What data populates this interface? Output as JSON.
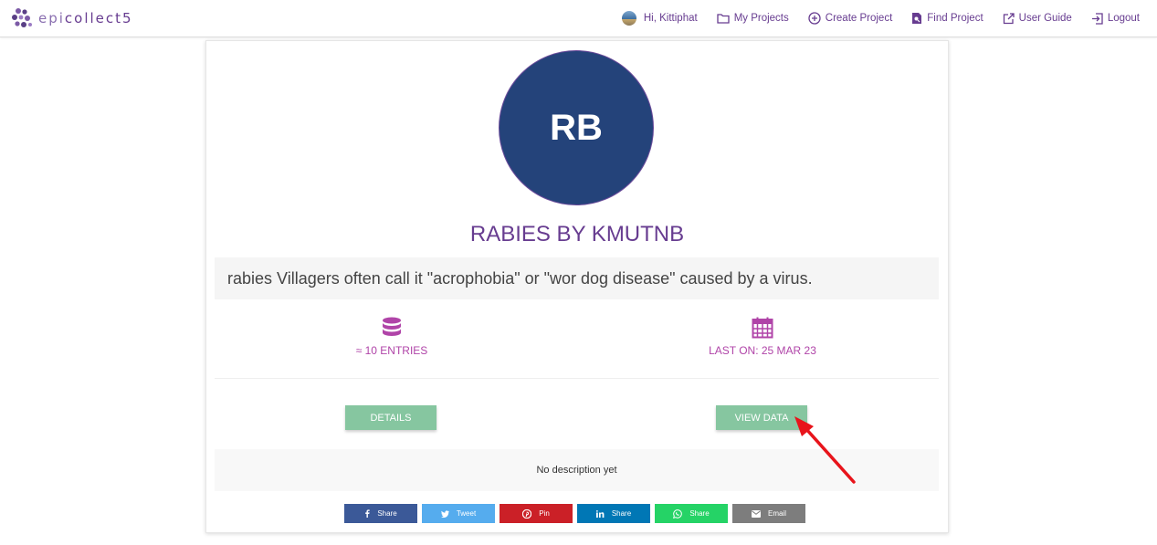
{
  "navbar": {
    "logo": {
      "prefix": "epi",
      "suffix": "collect5"
    },
    "greeting": "Hi, Kittiphat",
    "items": [
      {
        "label": "My Projects",
        "icon": "folder-icon"
      },
      {
        "label": "Create Project",
        "icon": "plus-circle-icon"
      },
      {
        "label": "Find Project",
        "icon": "search-file-icon"
      },
      {
        "label": "User Guide",
        "icon": "external-link-icon"
      },
      {
        "label": "Logout",
        "icon": "logout-icon"
      }
    ]
  },
  "project": {
    "logo_initials": "RB",
    "logo_color": "#24437a",
    "title": "RABIES BY KMUTNB",
    "small_description": "rabies Villagers often call it \"acrophobia\" or \"wor dog disease\" caused by a virus.",
    "entries": "≈ 10 ENTRIES",
    "last_on": "LAST ON: 25 MAR 23",
    "description": "No description yet"
  },
  "buttons": {
    "details": "DETAILS",
    "view_data": "VIEW DATA"
  },
  "share": [
    {
      "label": "Share",
      "network": "facebook",
      "icon": "facebook-icon"
    },
    {
      "label": "Tweet",
      "network": "twitter",
      "icon": "twitter-icon"
    },
    {
      "label": "Pin",
      "network": "pinterest",
      "icon": "pinterest-icon"
    },
    {
      "label": "Share",
      "network": "linkedin",
      "icon": "linkedin-icon"
    },
    {
      "label": "Share",
      "network": "whatsapp",
      "icon": "whatsapp-icon"
    },
    {
      "label": "Email",
      "network": "email",
      "icon": "email-icon"
    }
  ],
  "colors": {
    "brand_purple": "#673c90",
    "stat_magenta": "#b044a8",
    "button_green": "#86c6a0",
    "annotation_red": "#e8141b"
  }
}
